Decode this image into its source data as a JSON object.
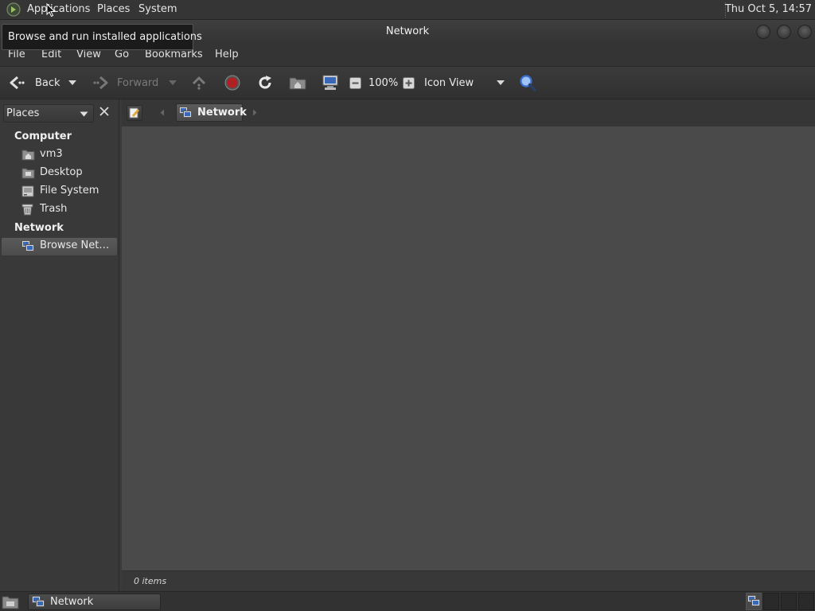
{
  "top_panel": {
    "menus": [
      "Applications",
      "Places",
      "System"
    ],
    "clock": "Thu Oct  5, 14:57",
    "logo_icon": "app-menu-logo-icon"
  },
  "tooltip": {
    "text": "Browse and run installed applications"
  },
  "window": {
    "title": "Network",
    "controls": [
      "minimize-icon",
      "maximize-icon",
      "close-icon"
    ]
  },
  "menubar": [
    "File",
    "Edit",
    "View",
    "Go",
    "Bookmarks",
    "Help"
  ],
  "toolbar": {
    "back": "Back",
    "forward": "Forward",
    "zoom": "100%",
    "view_mode": "Icon View"
  },
  "sidebar": {
    "selector": "Places",
    "computer_header": "Computer",
    "computer_items": [
      {
        "label": "vm3",
        "icon": "home-folder-icon"
      },
      {
        "label": "Desktop",
        "icon": "desktop-folder-icon"
      },
      {
        "label": "File System",
        "icon": "drive-icon"
      },
      {
        "label": "Trash",
        "icon": "trash-icon"
      }
    ],
    "network_header": "Network",
    "network_items": [
      {
        "label": "Browse Net…",
        "icon": "network-icon",
        "selected": true
      }
    ]
  },
  "location": {
    "crumb": "Network"
  },
  "status": {
    "text": "0 items"
  },
  "taskbar": {
    "task_label": "Network"
  },
  "colors": {
    "panel": "#353535",
    "window_bg": "#3a3a3a",
    "content_bg": "#4a4a4a",
    "sidebar_bg": "#393939",
    "selection": "#555555",
    "stop_red": "#b01f24",
    "search_blue": "#3b6fd0"
  }
}
